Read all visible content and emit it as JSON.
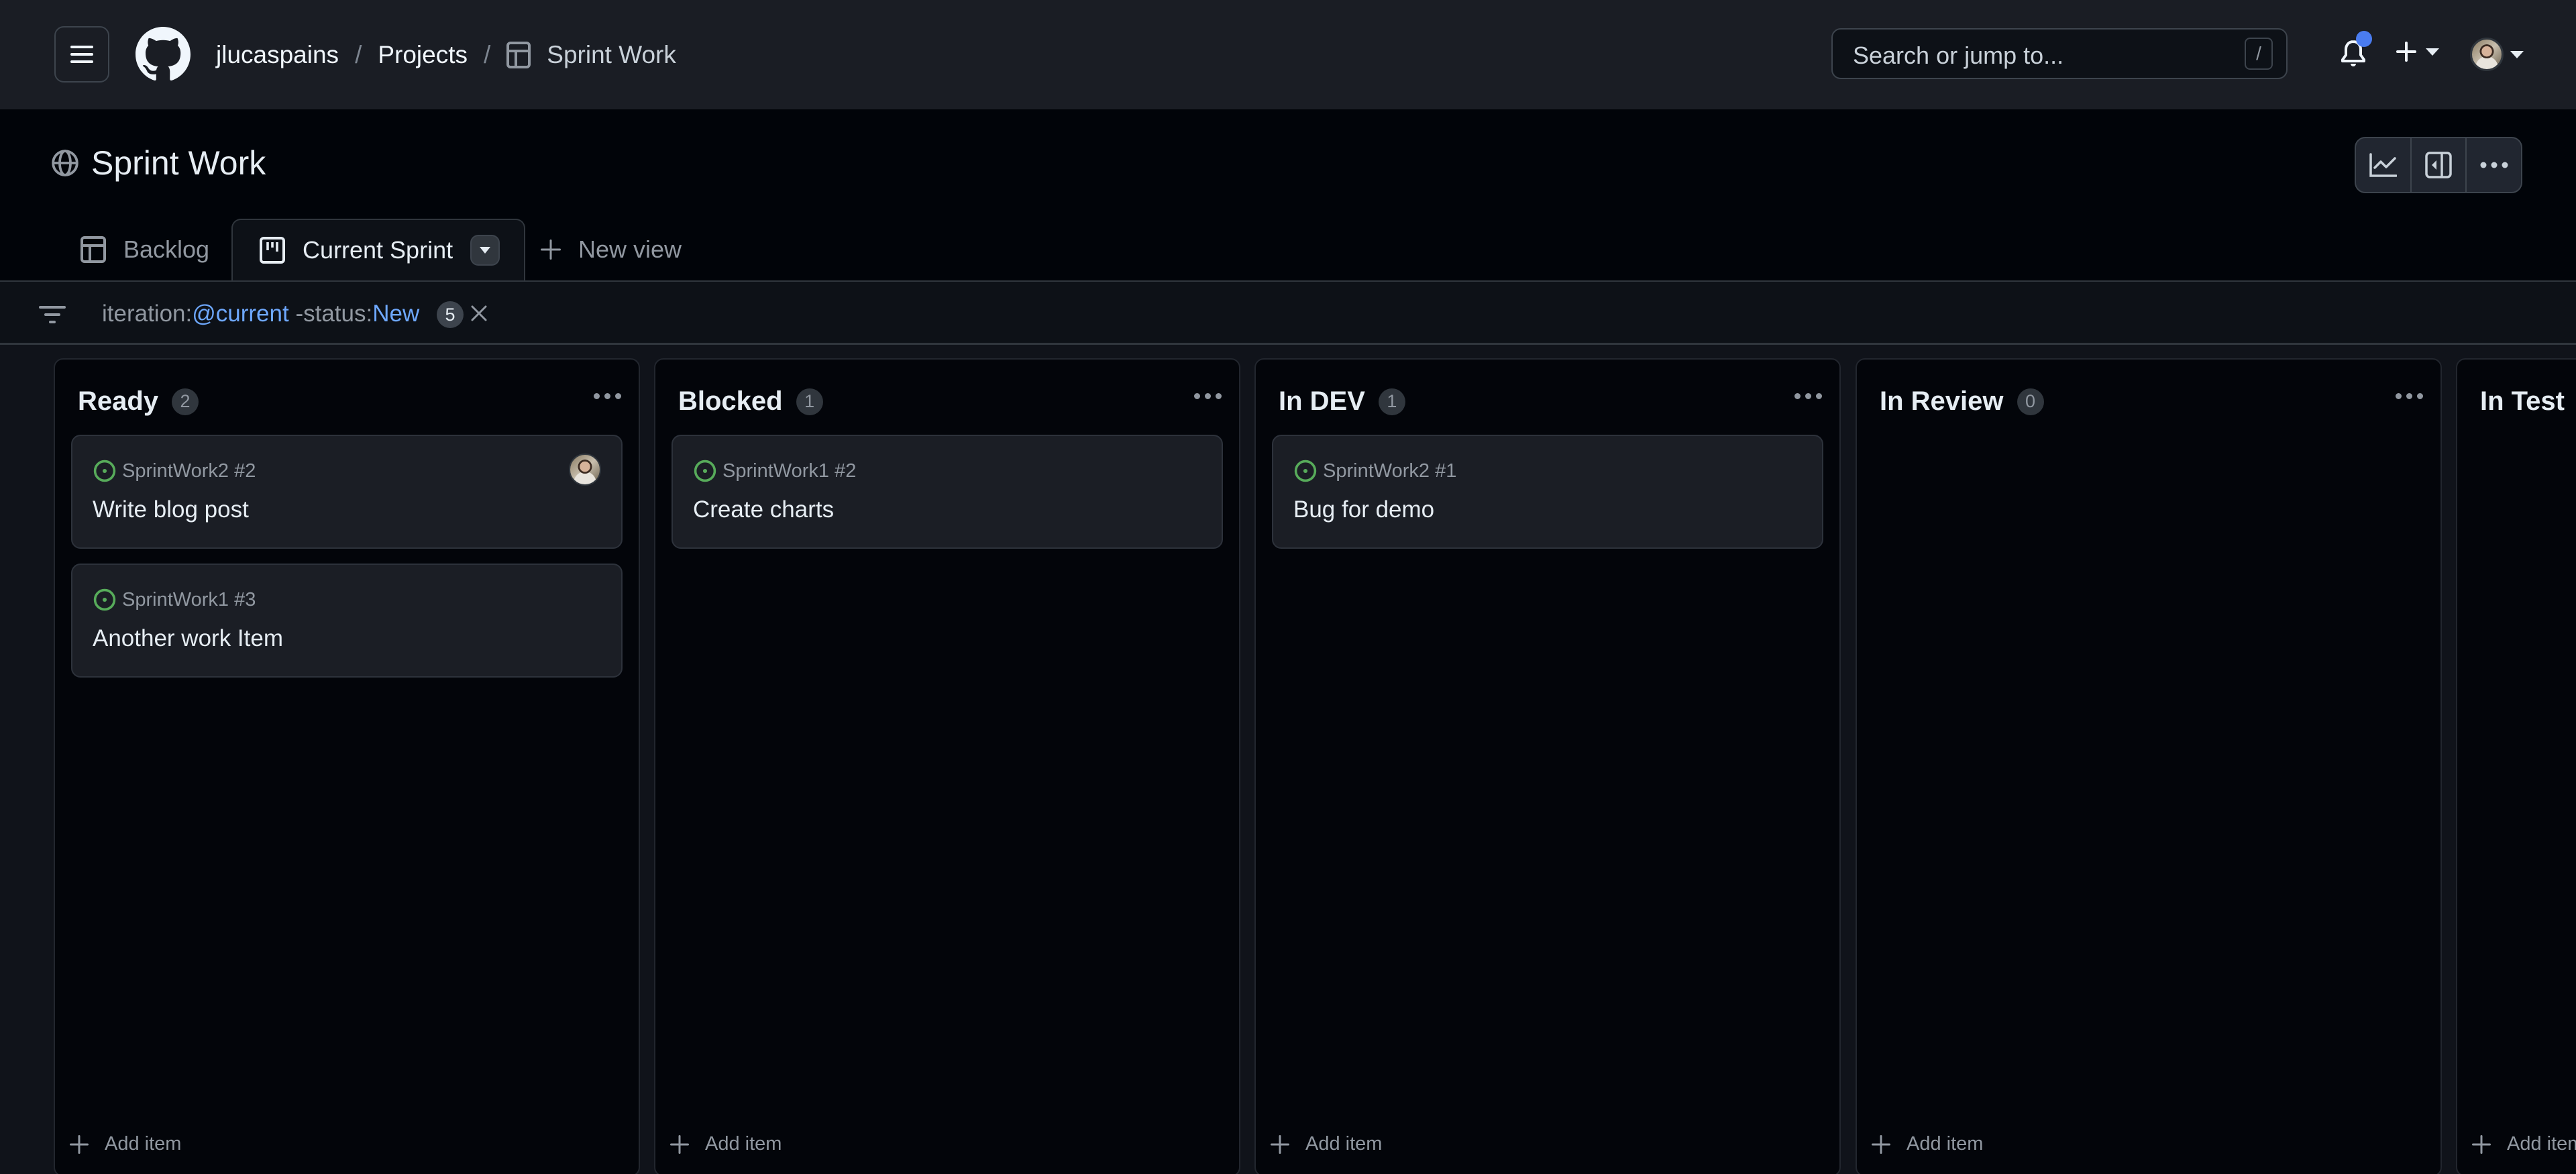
{
  "header": {
    "breadcrumbs": [
      "jlucaspains",
      "Projects",
      "Sprint Work"
    ],
    "breadcrumb_separator": "/",
    "search_placeholder": "Search or jump to...",
    "search_shortcut": "/",
    "notification_dot_color": "#4a7cf0"
  },
  "project": {
    "title": "Sprint Work",
    "visibility_icon": "globe-icon",
    "toolbar": [
      "insights-chart-icon",
      "side-panel-icon",
      "more-options-icon"
    ]
  },
  "tabs": [
    {
      "label": "Backlog",
      "icon": "table-icon",
      "active": false
    },
    {
      "label": "Current Sprint",
      "icon": "board-icon",
      "active": true
    },
    {
      "label": "New view",
      "icon": "plus-icon",
      "active": false
    }
  ],
  "filter": {
    "prefix": "iteration:",
    "value1": "@current",
    "middle": " -status:",
    "value2": "New",
    "count": "5",
    "highlight_color": "#6ea8fe"
  },
  "columns": [
    {
      "title": "Ready",
      "count": "2",
      "cards": [
        {
          "meta": "SprintWork2 #2",
          "title": "Write blog post",
          "assigned": true
        },
        {
          "meta": "SprintWork1 #3",
          "title": "Another work Item",
          "assigned": false
        }
      ],
      "add_label": "Add item"
    },
    {
      "title": "Blocked",
      "count": "1",
      "cards": [
        {
          "meta": "SprintWork1 #2",
          "title": "Create charts",
          "assigned": false
        }
      ],
      "add_label": "Add item"
    },
    {
      "title": "In DEV",
      "count": "1",
      "cards": [
        {
          "meta": "SprintWork2 #1",
          "title": "Bug for demo",
          "assigned": false
        }
      ],
      "add_label": "Add item"
    },
    {
      "title": "In Review",
      "count": "0",
      "cards": [],
      "add_label": "Add item"
    },
    {
      "title": "In Test",
      "count": "",
      "cards": [],
      "add_label": "Add item"
    }
  ],
  "status_open_color": "#57ab5a"
}
